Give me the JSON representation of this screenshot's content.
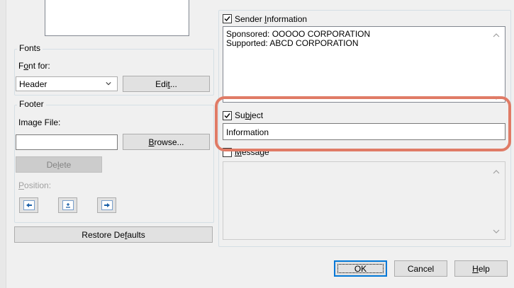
{
  "fonts": {
    "group_title": "Fonts",
    "font_for_label_pre": "F",
    "font_for_label_acc": "o",
    "font_for_label_post": "nt for:",
    "combo_value": "Header",
    "edit_pre": "Edi",
    "edit_acc": "t",
    "edit_post": "..."
  },
  "footer": {
    "group_title": "Footer",
    "image_file_label": "Image File:",
    "image_file_value": "",
    "browse_acc": "B",
    "browse_post": "rowse...",
    "delete_pre": "De",
    "delete_acc": "l",
    "delete_post": "ete",
    "position_acc": "P",
    "position_post": "osition:"
  },
  "restore": {
    "pre": "Restore De",
    "acc": "f",
    "post": "aults"
  },
  "sender": {
    "label_pre": "Sender ",
    "label_acc": "I",
    "label_post": "nformation",
    "checked": true,
    "line1": "Sponsored: OOOOO CORPORATION",
    "line2": "Supported: ABCD CORPORATION"
  },
  "subject": {
    "label_pre": "Su",
    "label_acc": "b",
    "label_post": "ject",
    "checked": true,
    "value": "Information"
  },
  "message": {
    "label_acc": "M",
    "label_post": "essage",
    "checked": false,
    "value": ""
  },
  "dialog_buttons": {
    "ok": "OK",
    "cancel": "Cancel",
    "help_acc": "H",
    "help_post": "elp"
  },
  "colors": {
    "highlight": "#e07b66",
    "default_button_border": "#0078d7"
  }
}
